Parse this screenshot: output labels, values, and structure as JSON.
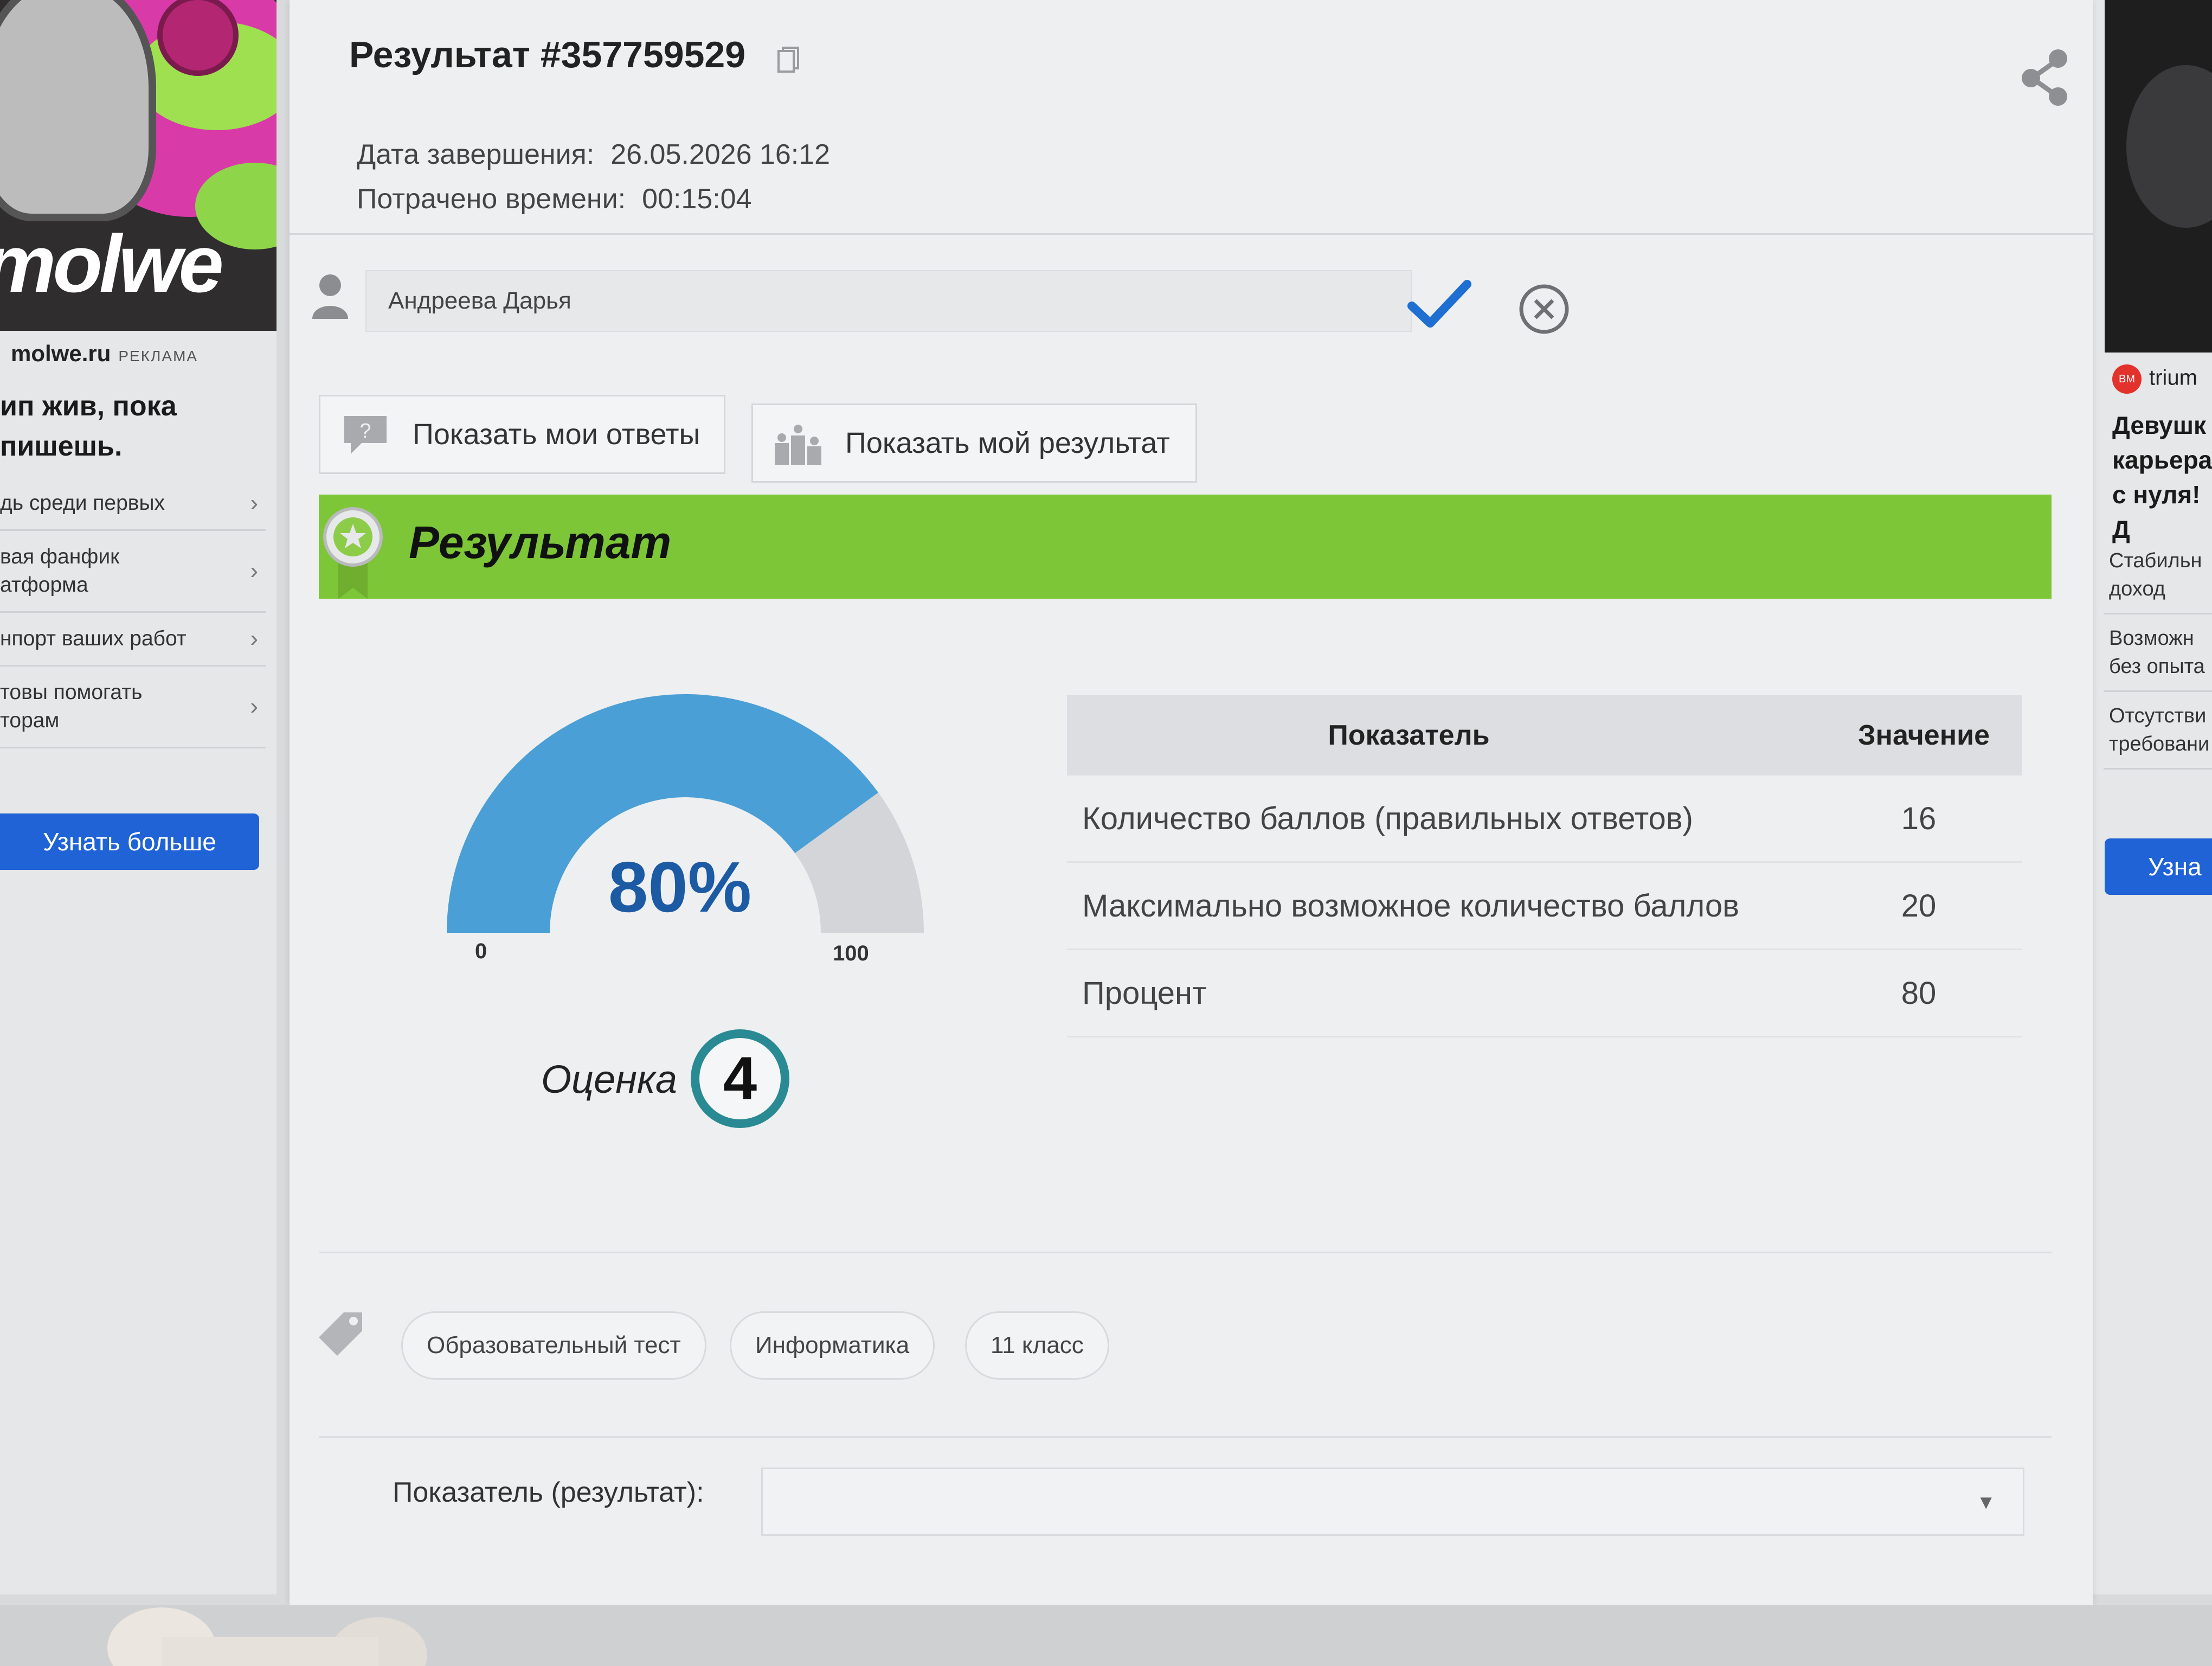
{
  "ad_left": {
    "logo_text": "molwe",
    "source": "molwe.ru",
    "ad_label": "РЕКЛАМА",
    "headline": "ип жив, пока\nпишешь.",
    "items": [
      "дь среди первых",
      "вая фанфик\nатформа",
      "нпорт ваших работ",
      "товы помогать\nторам"
    ],
    "cta": "Узнать больше"
  },
  "ad_right": {
    "source": "trium",
    "logo_text": "BM",
    "headline": "Девушк\nкарьера\nс нуля! Д",
    "items": [
      "Стабильн\nдоход",
      "Возможн\nбез опыта",
      "Отсутстви\nтребовани"
    ],
    "cta": "Узна"
  },
  "result": {
    "title": "Результат #357759529",
    "completion_label": "Дата завершения:",
    "completion_value": "26.05.2026 16:12",
    "time_label": "Потрачено времени:",
    "time_value": "00:15:04",
    "user_name": "Андреева Дарья",
    "btn_answers": "Показать мои ответы",
    "btn_result": "Показать мой результат",
    "banner_title": "Результат",
    "gauge": {
      "percent_text": "80%",
      "value": 80,
      "min": "0",
      "max": "100"
    },
    "grade_label": "Оценка",
    "grade_value": "4",
    "table": {
      "headers": [
        "Показатель",
        "Значение"
      ],
      "rows": [
        [
          "Количество баллов (правильных ответов)",
          "16"
        ],
        [
          "Максимально возможное количество баллов",
          "20"
        ],
        [
          "Процент",
          "80"
        ]
      ]
    },
    "tags": [
      "Образовательный тест",
      "Информатика",
      "11 класс"
    ],
    "filter_label": "Показатель (результат):"
  },
  "colors": {
    "banner_green": "#7cc637",
    "gauge_blue": "#4a9fd6",
    "gauge_rest": "#d4d5d8",
    "percent_text": "#1c5aa3",
    "grade_ring": "#2a8a93",
    "cta_blue": "#1f63d6",
    "check_blue": "#1e6fd1"
  },
  "icons": [
    "copy-icon",
    "share-icon",
    "user-icon",
    "check-icon",
    "cancel-icon",
    "question-bubble-icon",
    "podium-icon",
    "award-badge-icon",
    "tag-icon",
    "chevron-right-icon",
    "dropdown-caret-icon"
  ]
}
